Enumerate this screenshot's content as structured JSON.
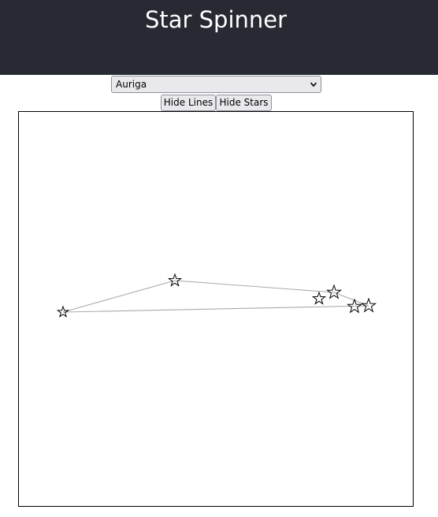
{
  "header": {
    "title": "Star Spinner"
  },
  "constellation_select": {
    "selected": "Auriga",
    "icon": "chevron-down-icon"
  },
  "buttons": {
    "hide_lines": "Hide Lines",
    "hide_stars": "Hide Stars"
  },
  "sky": {
    "constellation": "Auriga",
    "line_color": "#aaaaaa",
    "star_color": "#000000",
    "star_icon": "star-outline-icon"
  }
}
